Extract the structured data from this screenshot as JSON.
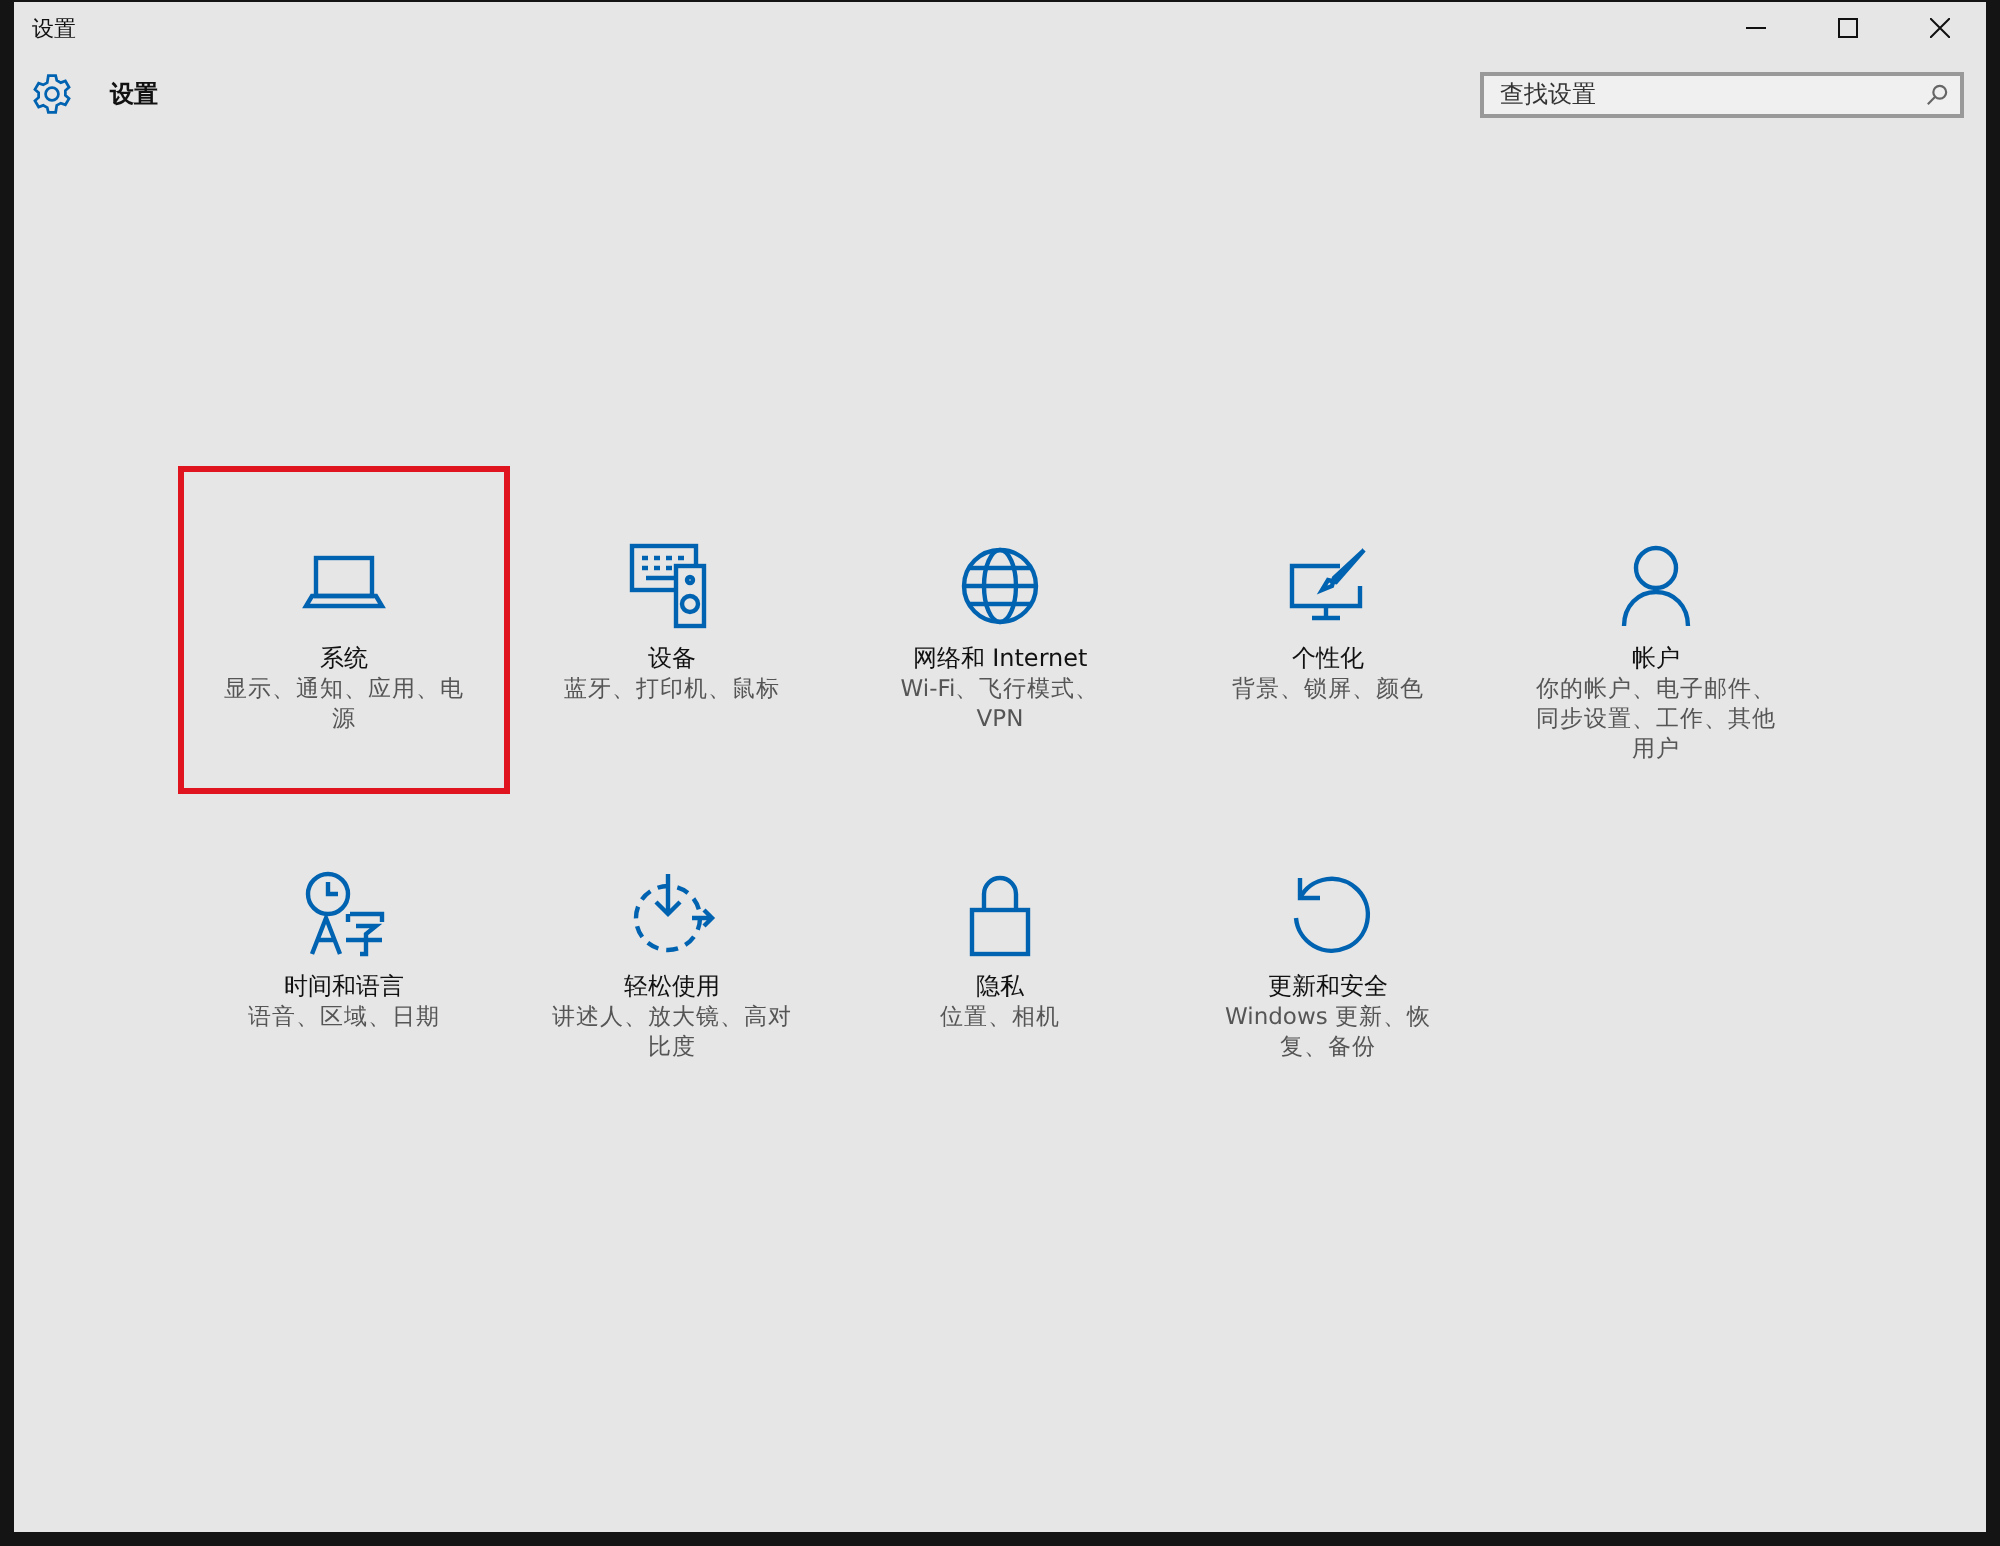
{
  "window": {
    "title": "设置"
  },
  "header": {
    "title": "设置"
  },
  "search": {
    "placeholder": "查找设置"
  },
  "tiles": [
    {
      "kind": "laptop",
      "title": "系统",
      "description": "显示、通知、应用、电源",
      "highlighted": true
    },
    {
      "kind": "devices",
      "title": "设备",
      "description": "蓝牙、打印机、鼠标",
      "highlighted": false
    },
    {
      "kind": "globe",
      "title": "网络和 Internet",
      "description": "Wi-Fi、飞行模式、VPN",
      "highlighted": false
    },
    {
      "kind": "paint",
      "title": "个性化",
      "description": "背景、锁屏、颜色",
      "highlighted": false
    },
    {
      "kind": "person",
      "title": "帐户",
      "description": "你的帐户、电子邮件、同步设置、工作、其他用户",
      "highlighted": false
    },
    {
      "kind": "timelang",
      "title": "时间和语言",
      "description": "语音、区域、日期",
      "highlighted": false
    },
    {
      "kind": "ease",
      "title": "轻松使用",
      "description": "讲述人、放大镜、高对比度",
      "highlighted": false
    },
    {
      "kind": "lock",
      "title": "隐私",
      "description": "位置、相机",
      "highlighted": false
    },
    {
      "kind": "update",
      "title": "更新和安全",
      "description": "Windows 更新、恢复、备份",
      "highlighted": false
    }
  ]
}
